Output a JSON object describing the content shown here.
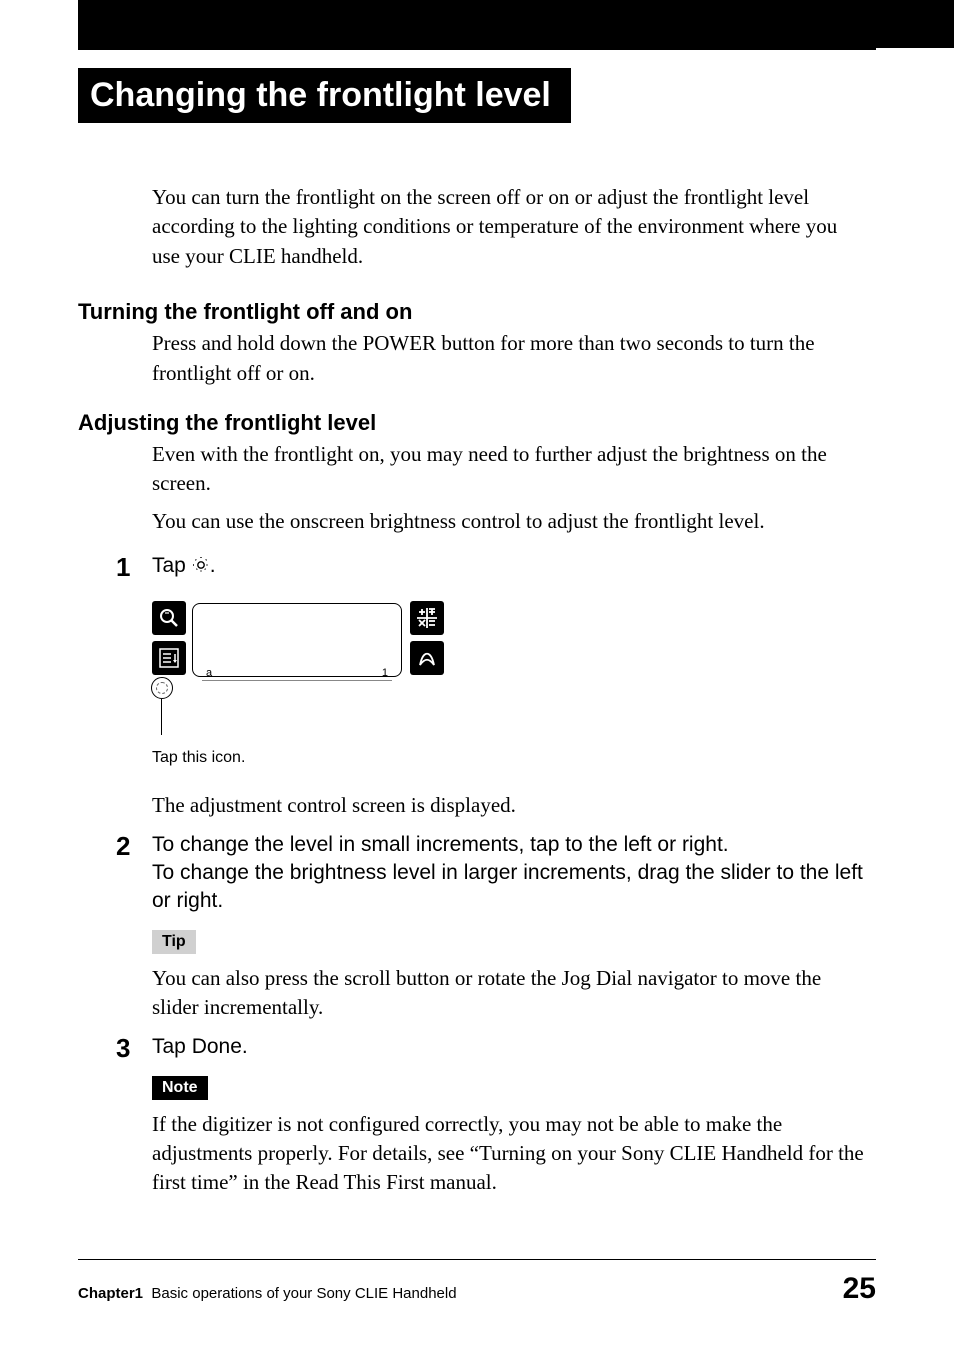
{
  "page_title": "Changing the frontlight level",
  "intro": "You can turn the frontlight on the screen off or on or adjust the frontlight level according to the lighting conditions or temperature of the environment where you use your CLIE handheld.",
  "section1": {
    "heading": "Turning the frontlight off and on",
    "body": "Press and hold down the POWER button for more than two seconds to turn the frontlight off or on."
  },
  "section2": {
    "heading": "Adjusting the frontlight level",
    "p1": "Even with the frontlight on, you may need to further adjust the brightness on the screen.",
    "p2": "You can use the onscreen brightness control to adjust the frontlight level."
  },
  "steps": {
    "s1": {
      "num": "1",
      "prefix": "Tap ",
      "suffix": "."
    },
    "tap_caption": "Tap this icon.",
    "after_illustration": "The adjustment control screen is displayed.",
    "s2": {
      "num": "2",
      "text": "To change the level in small increments, tap to the left or right.\nTo change the brightness level in larger increments, drag the slider to the left or right."
    },
    "tip_label": "Tip",
    "tip_body": "You can also press the scroll button or rotate the Jog Dial navigator to move the slider incrementally.",
    "s3": {
      "num": "3",
      "text": "Tap Done."
    },
    "note_label": "Note",
    "note_body": "If the digitizer is not configured correctly, you may not be able to make the adjustments properly. For details, see “Turning on your Sony CLIE Handheld for the first time” in the Read This First manual."
  },
  "illustration": {
    "letter_a": "a",
    "number_1": "1"
  },
  "footer": {
    "chapter": "Chapter1",
    "chapter_title": "Basic operations of your Sony CLIE Handheld",
    "page": "25"
  }
}
